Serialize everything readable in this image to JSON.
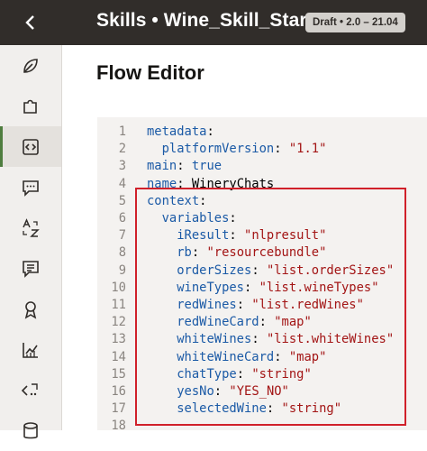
{
  "header": {
    "title": "Skills • Wine_Skill_Starter",
    "badge": "Draft • 2.0 – 21.04"
  },
  "page": {
    "heading": "Flow Editor"
  },
  "sidebar": {
    "items": [
      {
        "name": "sidebar-item-intents",
        "icon": "leaf-icon"
      },
      {
        "name": "sidebar-item-entities",
        "icon": "puzzle-icon"
      },
      {
        "name": "sidebar-item-flows",
        "icon": "code-icon",
        "active": true
      },
      {
        "name": "sidebar-item-resources",
        "icon": "chat-icon"
      },
      {
        "name": "sidebar-item-translation",
        "icon": "translate-icon"
      },
      {
        "name": "sidebar-item-settings",
        "icon": "form-icon"
      },
      {
        "name": "sidebar-item-quality",
        "icon": "award-icon"
      },
      {
        "name": "sidebar-item-insights",
        "icon": "chart-icon"
      },
      {
        "name": "sidebar-item-components",
        "icon": "api-icon"
      },
      {
        "name": "sidebar-item-data",
        "icon": "database-icon"
      }
    ]
  },
  "editor": {
    "lines": [
      {
        "n": "1",
        "indent": "",
        "key": "metadata",
        "sep": ":",
        "value": "",
        "vtype": ""
      },
      {
        "n": "2",
        "indent": "  ",
        "key": "platformVersion",
        "sep": ": ",
        "value": "\"1.1\"",
        "vtype": "s"
      },
      {
        "n": "3",
        "indent": "",
        "key": "main",
        "sep": ": ",
        "value": "true",
        "vtype": "k"
      },
      {
        "n": "4",
        "indent": "",
        "key": "name",
        "sep": ": ",
        "value": "WineryChats",
        "vtype": "p"
      },
      {
        "n": "5",
        "indent": "",
        "key": "context",
        "sep": ":",
        "value": "",
        "vtype": ""
      },
      {
        "n": "6",
        "indent": "  ",
        "key": "variables",
        "sep": ":",
        "value": "",
        "vtype": ""
      },
      {
        "n": "7",
        "indent": "    ",
        "key": "iResult",
        "sep": ": ",
        "value": "\"nlpresult\"",
        "vtype": "s"
      },
      {
        "n": "8",
        "indent": "    ",
        "key": "rb",
        "sep": ": ",
        "value": "\"resourcebundle\"",
        "vtype": "s"
      },
      {
        "n": "9",
        "indent": "    ",
        "key": "orderSizes",
        "sep": ": ",
        "value": "\"list.orderSizes\"",
        "vtype": "s"
      },
      {
        "n": "10",
        "indent": "    ",
        "key": "wineTypes",
        "sep": ": ",
        "value": "\"list.wineTypes\"",
        "vtype": "s"
      },
      {
        "n": "11",
        "indent": "    ",
        "key": "redWines",
        "sep": ": ",
        "value": "\"list.redWines\"",
        "vtype": "s"
      },
      {
        "n": "12",
        "indent": "    ",
        "key": "redWineCard",
        "sep": ": ",
        "value": "\"map\"",
        "vtype": "s"
      },
      {
        "n": "13",
        "indent": "    ",
        "key": "whiteWines",
        "sep": ": ",
        "value": "\"list.whiteWines\"",
        "vtype": "s"
      },
      {
        "n": "14",
        "indent": "    ",
        "key": "whiteWineCard",
        "sep": ": ",
        "value": "\"map\"",
        "vtype": "s"
      },
      {
        "n": "15",
        "indent": "    ",
        "key": "chatType",
        "sep": ": ",
        "value": "\"string\"",
        "vtype": "s"
      },
      {
        "n": "16",
        "indent": "    ",
        "key": "yesNo",
        "sep": ": ",
        "value": "\"YES_NO\"",
        "vtype": "s"
      },
      {
        "n": "17",
        "indent": "    ",
        "key": "selectedWine",
        "sep": ": ",
        "value": "\"string\"",
        "vtype": "s"
      },
      {
        "n": "18",
        "indent": "",
        "key": "",
        "sep": "",
        "value": "",
        "vtype": ""
      }
    ]
  }
}
